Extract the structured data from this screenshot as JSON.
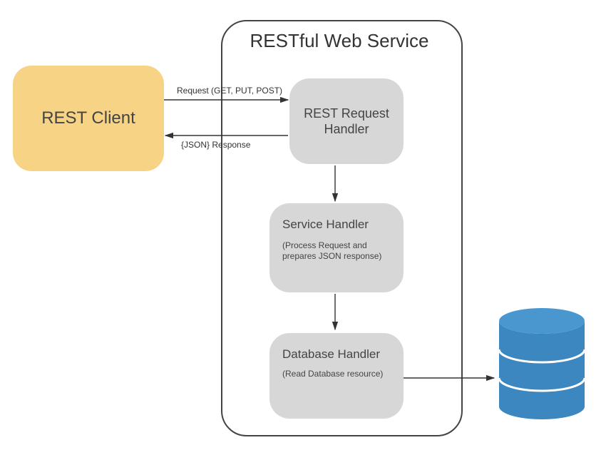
{
  "client": {
    "label": "REST Client"
  },
  "service": {
    "title": "RESTful Web Service",
    "request_handler": {
      "label": "REST Request Handler"
    },
    "service_handler": {
      "label": "Service Handler",
      "sub": "(Process Request and prepares JSON response)"
    },
    "database_handler": {
      "label": "Database Handler",
      "sub": "(Read Database resource)"
    }
  },
  "edges": {
    "request_label": "Request (GET, PUT, POST)",
    "response_label": "{JSON} Response"
  },
  "database": {
    "name": "database-cylinder"
  }
}
